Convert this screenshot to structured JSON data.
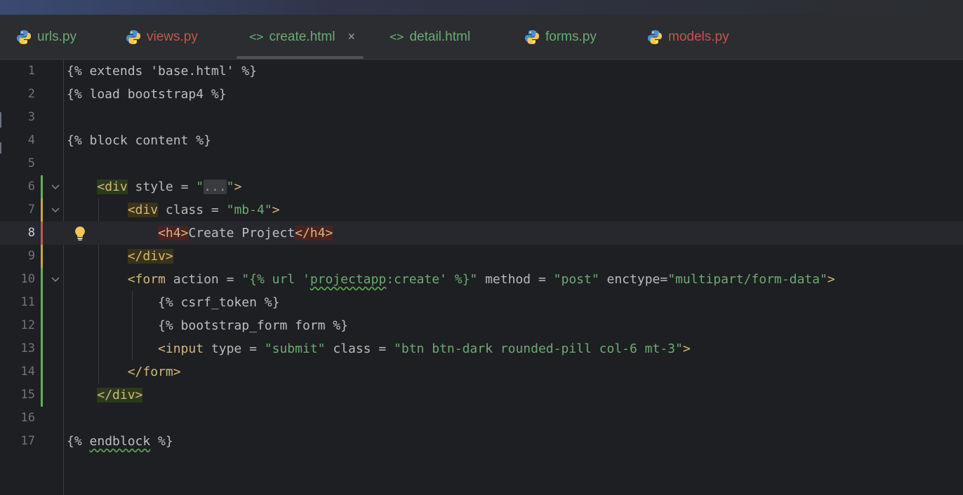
{
  "tabs": [
    {
      "label": "urls.py",
      "icon": "python-icon",
      "color": "#6aab73"
    },
    {
      "label": "views.py",
      "icon": "python-icon",
      "color": "#c75450"
    },
    {
      "label": "create.html",
      "icon": "html-tag-icon",
      "color": "#6aab73",
      "active": true,
      "close": "×"
    },
    {
      "label": "detail.html",
      "icon": "html-tag-icon",
      "color": "#6aab73"
    },
    {
      "label": "forms.py",
      "icon": "python-icon",
      "color": "#6aab73"
    },
    {
      "label": "models.py",
      "icon": "python-icon",
      "color": "#c75450"
    }
  ],
  "editor": {
    "current_line": 8,
    "line_numbers": [
      "1",
      "2",
      "3",
      "4",
      "5",
      "6",
      "7",
      "8",
      "9",
      "10",
      "11",
      "12",
      "13",
      "14",
      "15",
      "16",
      "17"
    ],
    "code": {
      "l1": "{% extends 'base.html' %}",
      "l2": "{% load bootstrap4 %}",
      "l4": "{% block content %}",
      "l6": {
        "open": "<div",
        "attr": " style ",
        "eq": "= ",
        "q1": "\"",
        "fold": "...",
        "q2": "\"",
        "close": ">"
      },
      "l7": {
        "open": "<div",
        "attr": " class ",
        "eq": "= ",
        "val": "\"mb-4\"",
        "close": ">"
      },
      "l8": {
        "open": "<h4>",
        "text": "Create Project",
        "close": "</h4>"
      },
      "l9": "</div>",
      "l10": {
        "open": "<form",
        "attr1": " action ",
        "eq1": "= ",
        "val1a": "\"{% url '",
        "val1b": "projectapp",
        "val1c": ":create' %}\"",
        "attr2": " method ",
        "eq2": "= ",
        "val2": "\"post\"",
        "attr3": " enctype",
        "eq3": "=",
        "val3": "\"multipart/form-data\"",
        "close": ">"
      },
      "l11": "{% csrf_token %}",
      "l12": "{% bootstrap_form form %}",
      "l13": {
        "open": "<input",
        "attr1": " type ",
        "eq1": "= ",
        "val1": "\"submit\"",
        "attr2": " class ",
        "eq2": "= ",
        "val2": "\"btn btn-dark rounded-pill col-6 mt-3\"",
        "close": ">"
      },
      "l14": "</form>",
      "l15": "</div>",
      "l17a": "{% ",
      "l17b": "endblock",
      "l17c": " %}"
    }
  },
  "colors": {
    "tag": "#d5b778",
    "string": "#6aab73",
    "text": "#bcbec4",
    "added": "#5fb357",
    "modified": "#c9a644",
    "deleted": "#c75450"
  }
}
